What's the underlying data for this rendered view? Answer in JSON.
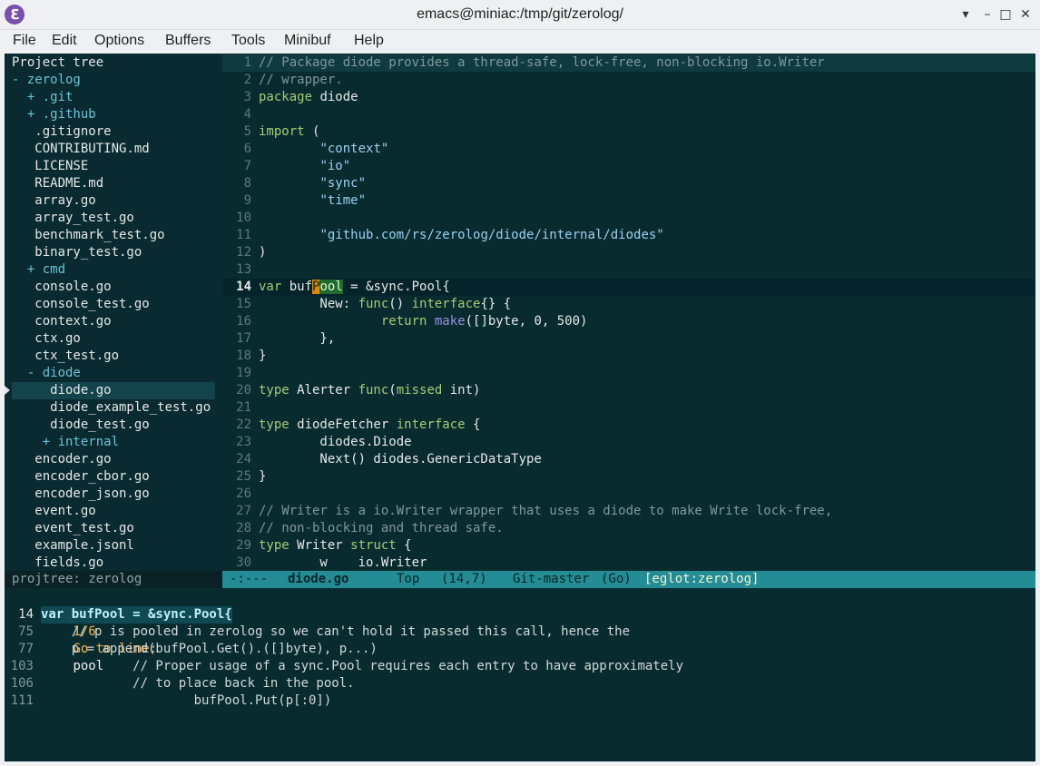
{
  "window": {
    "title": "emacs@miniac:/tmp/git/zerolog/",
    "icon": "emacs-icon",
    "icon_glyph": "ℇ",
    "minimize_glyph": "▾",
    "minimize2_glyph": "–",
    "maximize_glyph": "□",
    "close_glyph": "✕"
  },
  "menubar": {
    "items": [
      "File",
      "Edit",
      "Options",
      "Buffers",
      "Tools",
      "Minibuf",
      "Help"
    ]
  },
  "projtree": {
    "header": "Project tree",
    "rows": [
      {
        "text": "- zerolog",
        "dir": true
      },
      {
        "text": "  + .git",
        "dir": true
      },
      {
        "text": "  + .github",
        "dir": true
      },
      {
        "text": "   .gitignore",
        "dir": false
      },
      {
        "text": "   CONTRIBUTING.md",
        "dir": false
      },
      {
        "text": "   LICENSE",
        "dir": false
      },
      {
        "text": "   README.md",
        "dir": false
      },
      {
        "text": "   array.go",
        "dir": false
      },
      {
        "text": "   array_test.go",
        "dir": false
      },
      {
        "text": "   benchmark_test.go",
        "dir": false
      },
      {
        "text": "   binary_test.go",
        "dir": false
      },
      {
        "text": "  + cmd",
        "dir": true
      },
      {
        "text": "   console.go",
        "dir": false
      },
      {
        "text": "   console_test.go",
        "dir": false
      },
      {
        "text": "   context.go",
        "dir": false
      },
      {
        "text": "   ctx.go",
        "dir": false
      },
      {
        "text": "   ctx_test.go",
        "dir": false
      },
      {
        "text": "  - diode",
        "dir": true
      },
      {
        "text": "     diode.go",
        "dir": false
      },
      {
        "text": "     diode_example_test.go",
        "dir": false
      },
      {
        "text": "     diode_test.go",
        "dir": false
      },
      {
        "text": "    + internal",
        "dir": true
      },
      {
        "text": "   encoder.go",
        "dir": false
      },
      {
        "text": "   encoder_cbor.go",
        "dir": false
      },
      {
        "text": "   encoder_json.go",
        "dir": false
      },
      {
        "text": "   event.go",
        "dir": false
      },
      {
        "text": "   event_test.go",
        "dir": false
      },
      {
        "text": "   example.jsonl",
        "dir": false
      },
      {
        "text": "   fields.go",
        "dir": false
      }
    ],
    "modeline": "projtree: zerolog"
  },
  "editor": {
    "lines": [
      {
        "n": "1",
        "html": "<span class='cmt'>// Package diode provides a thread-safe, lock-free, non-blocking io.Writer</span>"
      },
      {
        "n": "2",
        "html": "<span class='cmt'>// wrapper.</span>"
      },
      {
        "n": "3",
        "html": "<span class='kw'>package</span> diode"
      },
      {
        "n": "4",
        "html": ""
      },
      {
        "n": "5",
        "html": "<span class='kw'>import</span> ("
      },
      {
        "n": "6",
        "html": "        <span class='str'>\"context\"</span>"
      },
      {
        "n": "7",
        "html": "        <span class='str'>\"io\"</span>"
      },
      {
        "n": "8",
        "html": "        <span class='str'>\"sync\"</span>"
      },
      {
        "n": "9",
        "html": "        <span class='str'>\"time\"</span>"
      },
      {
        "n": "10",
        "html": ""
      },
      {
        "n": "11",
        "html": "        <span class='str'>\"github.com/rs/zerolog/diode/internal/diodes\"</span>"
      },
      {
        "n": "12",
        "html": ")"
      },
      {
        "n": "13",
        "html": ""
      },
      {
        "n": "14",
        "html": "<span class='kw'>var</span> buf<span class='cursor'>P</span><span class='match'>ool</span> = &amp;sync.Pool{"
      },
      {
        "n": "15",
        "html": "        New: <span class='kw'>func</span>() <span class='kw'>interface</span>{} {"
      },
      {
        "n": "16",
        "html": "                <span class='kw'>return</span> <span class='fn'>make</span>([]byte, 0, 500)"
      },
      {
        "n": "17",
        "html": "        },"
      },
      {
        "n": "18",
        "html": "}"
      },
      {
        "n": "19",
        "html": ""
      },
      {
        "n": "20",
        "html": "<span class='kw'>type</span> Alerter <span class='kw'>func</span>(<span class='kw'>missed</span> int)"
      },
      {
        "n": "21",
        "html": ""
      },
      {
        "n": "22",
        "html": "<span class='kw'>type</span> diodeFetcher <span class='kw'>interface</span> {"
      },
      {
        "n": "23",
        "html": "        diodes.Diode"
      },
      {
        "n": "24",
        "html": "        Next() diodes.GenericDataType"
      },
      {
        "n": "25",
        "html": "}"
      },
      {
        "n": "26",
        "html": ""
      },
      {
        "n": "27",
        "html": "<span class='cmt'>// Writer is a io.Writer wrapper that uses a diode to make Write lock-free,</span>"
      },
      {
        "n": "28",
        "html": "<span class='cmt'>// non-blocking and thread safe.</span>"
      },
      {
        "n": "29",
        "html": "<span class='kw'>type</span> Writer <span class='kw'>struct</span> {"
      },
      {
        "n": "30",
        "html": "        w    io.Writer"
      }
    ],
    "modeline": {
      "status": "-:---",
      "buffer": "diode.go",
      "position": "Top",
      "linecol": "(14,7)",
      "vc": "Git-master",
      "mode": "(Go)",
      "eglot": "[eglot:zerolog]"
    }
  },
  "minibuffer": {
    "prompt_count": "1/6",
    "prompt_label": "Go to line:",
    "input": "pool",
    "candidates": [
      {
        "n": "14",
        "text": "var bufPool = &sync.Pool{",
        "selected": true
      },
      {
        "n": "75",
        "text": "    // p is pooled in zerolog so we can't hold it passed this call, hence the",
        "selected": false
      },
      {
        "n": "77",
        "text": "    p = append(bufPool.Get().([]byte), p...)",
        "selected": false
      },
      {
        "n": "103",
        "text": "            // Proper usage of a sync.Pool requires each entry to have approximately",
        "selected": false
      },
      {
        "n": "106",
        "text": "            // to place back in the pool.",
        "selected": false
      },
      {
        "n": "111",
        "text": "                    bufPool.Put(p[:0])",
        "selected": false
      }
    ]
  }
}
